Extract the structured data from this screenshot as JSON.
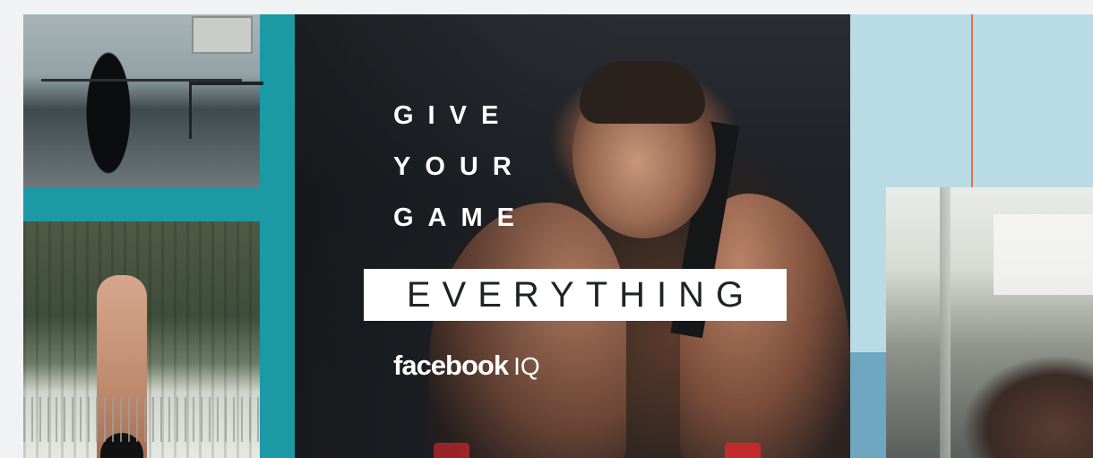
{
  "hero": {
    "headline_lines": [
      "GIVE",
      "YOUR",
      "GAME"
    ],
    "highlight_word": "EVERYTHING",
    "brand_name": "facebook",
    "brand_suffix": "IQ"
  },
  "colors": {
    "teal_panel": "#1b9aa6",
    "light_blue_panel": "#b8dbe6",
    "mid_blue_panel": "#6fa6c0",
    "accent_line": "#e07548",
    "headline_text": "#ffffff",
    "highlight_box": "#ffffff",
    "highlight_text": "#1f2326"
  }
}
